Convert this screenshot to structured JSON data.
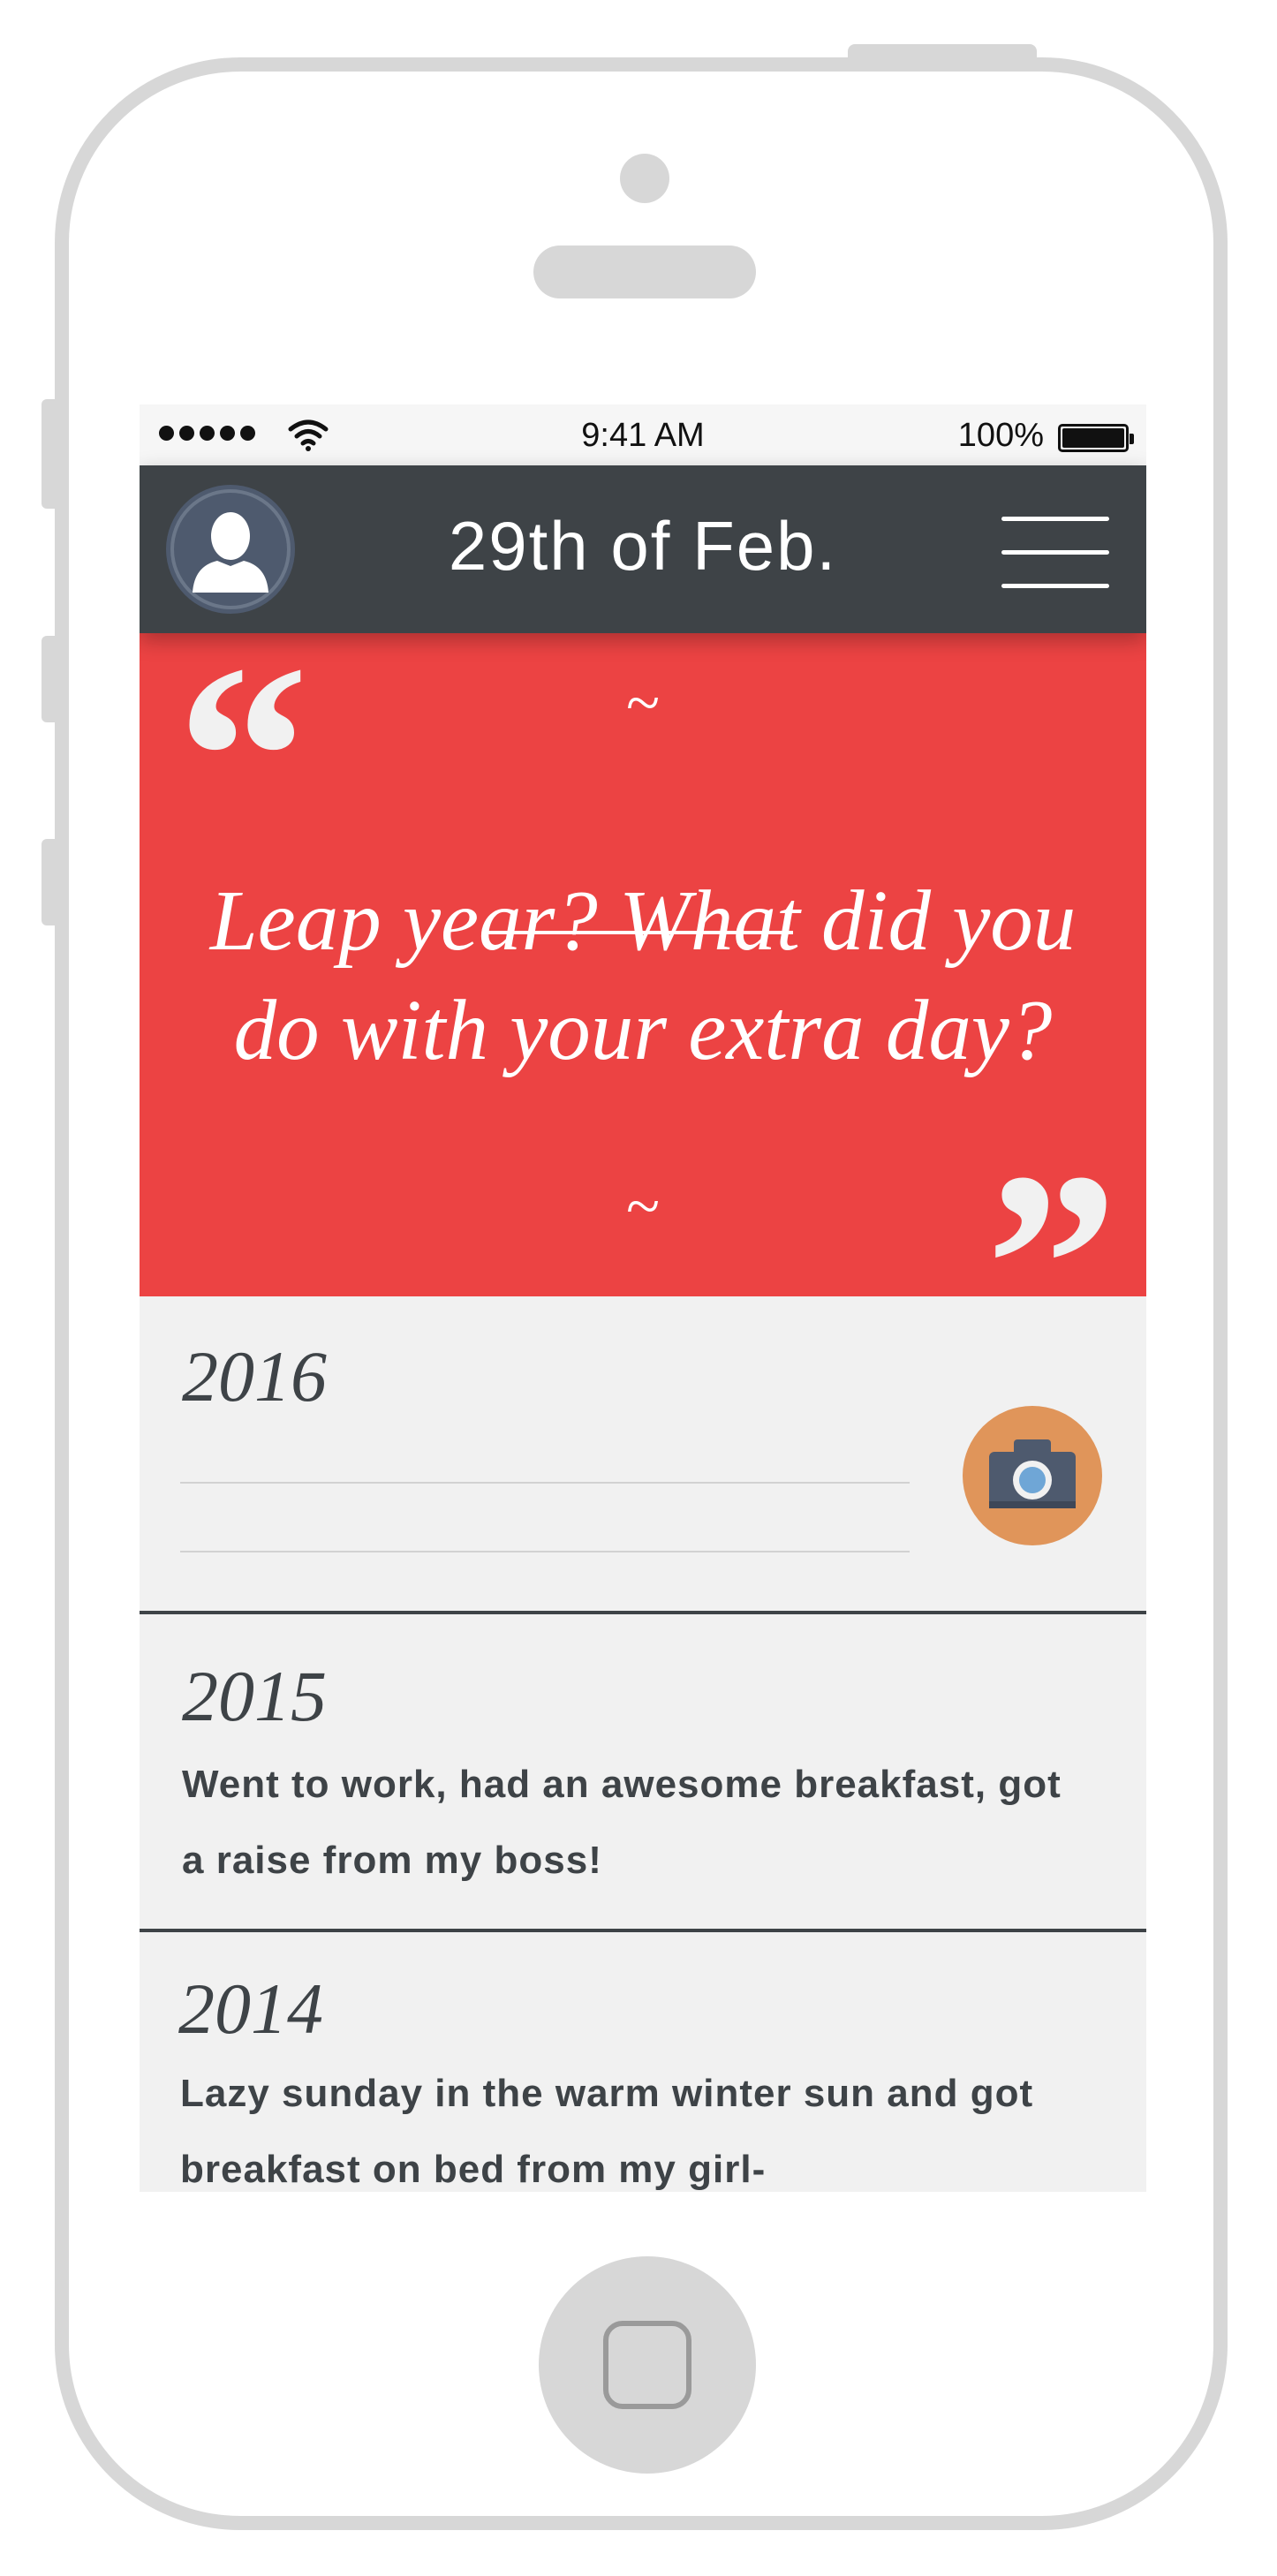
{
  "status_bar": {
    "time": "9:41 AM",
    "battery_percent": "100%"
  },
  "nav": {
    "title": "29th of Feb."
  },
  "quote": {
    "tilde_top": "~",
    "text": "Leap year? What did you do with your extra day?",
    "tilde_bottom": "~",
    "open_mark": "“",
    "close_mark": "”"
  },
  "entries": [
    {
      "year": "2016",
      "text": ""
    },
    {
      "year": "2015",
      "text": "Went to work, had an awesome breakfast, got a raise from my boss!"
    },
    {
      "year": "2014",
      "text": "Lazy sunday in the warm winter sun and got breakfast on bed from my girl-"
    }
  ],
  "colors": {
    "nav_background": "#3e4347",
    "quote_background": "#ec4343",
    "camera_button": "#e0955a",
    "avatar_background": "#4e5a6e",
    "entry_background": "#f1f1f1"
  },
  "icons": {
    "avatar": "person-silhouette-icon",
    "menu": "hamburger-menu-icon",
    "camera": "camera-icon",
    "home": "home-button-square-icon"
  }
}
